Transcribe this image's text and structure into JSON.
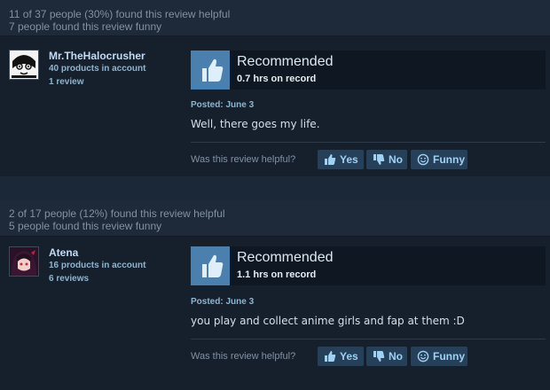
{
  "colors": {
    "page_bg": "#1b2838",
    "review_bg": "#16202d",
    "thumb_bg": "#4a7fae",
    "button_bg": "#26405a",
    "button_text": "#9fd1f5"
  },
  "reviews": [
    {
      "helpful": "11 of 37 people (30%) found this review helpful",
      "funny": "7 people found this review funny",
      "user": {
        "name": "Mr.TheHalocrusher",
        "products": "40 products in account",
        "reviews": "1 review",
        "avatar_icon": "anime-face-avatar"
      },
      "recommendation": "Recommended",
      "thumb_icon": "thumbs-up-icon",
      "hours": "0.7 hrs on record",
      "posted": "Posted: June 3",
      "text": "Well, there goes my life.",
      "question": "Was this review helpful?",
      "buttons": {
        "yes": "Yes",
        "no": "No",
        "funny": "Funny"
      }
    },
    {
      "helpful": "2 of 17 people (12%) found this review helpful",
      "funny": "5 people found this review funny",
      "user": {
        "name": "Atena",
        "products": "16 products in account",
        "reviews": "6 reviews",
        "avatar_icon": "anime-girl-avatar"
      },
      "recommendation": "Recommended",
      "thumb_icon": "thumbs-up-icon",
      "hours": "1.1 hrs on record",
      "posted": "Posted: June 3",
      "text": "you play and collect anime girls and fap at them :D",
      "question": "Was this review helpful?",
      "buttons": {
        "yes": "Yes",
        "no": "No",
        "funny": "Funny"
      }
    }
  ]
}
